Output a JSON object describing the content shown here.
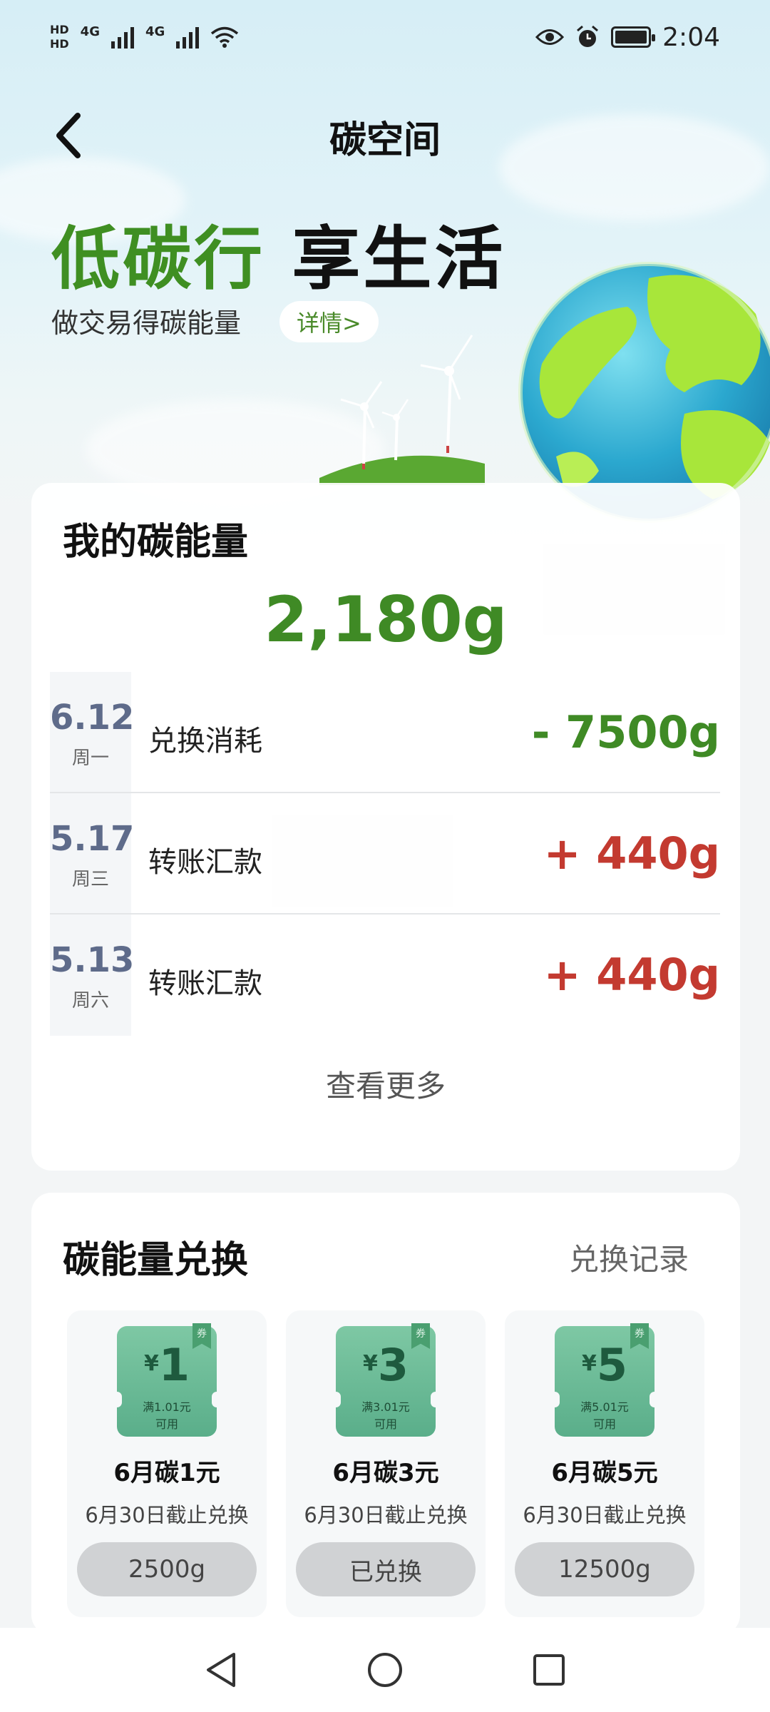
{
  "status_bar": {
    "sim1_label": "HD",
    "sim2_label": "HD",
    "network1": "4G",
    "network2": "4G",
    "time": "2:04",
    "icons": [
      "signal-icon",
      "wifi-icon",
      "eye-icon",
      "alarm-icon",
      "battery-icon"
    ]
  },
  "header": {
    "title": "碳空间",
    "back_icon": "back-chevron-icon"
  },
  "hero": {
    "slogan_green": "低碳行",
    "slogan_dark": "享生活",
    "subtitle": "做交易得碳能量",
    "details_label": "详情>"
  },
  "energy": {
    "title": "我的碳能量",
    "value": "2,180g",
    "records": [
      {
        "date": "6.12",
        "weekday": "周一",
        "label": "兑换消耗",
        "amount": "- 7500g",
        "type": "minus"
      },
      {
        "date": "5.17",
        "weekday": "周三",
        "label": "转账汇款",
        "amount": "+ 440g",
        "type": "plus"
      },
      {
        "date": "5.13",
        "weekday": "周六",
        "label": "转账汇款",
        "amount": "+ 440g",
        "type": "plus"
      }
    ],
    "view_more": "查看更多"
  },
  "exchange": {
    "title": "碳能量兑换",
    "record_link": "兑换记录",
    "coupons": [
      {
        "yen": "¥",
        "amount": "1",
        "cond1": "满1.01元",
        "cond2": "可用",
        "tag": "券",
        "name": "6月碳1元",
        "deadline": "6月30日截止兑换",
        "button": "2500g"
      },
      {
        "yen": "¥",
        "amount": "3",
        "cond1": "满3.01元",
        "cond2": "可用",
        "tag": "券",
        "name": "6月碳3元",
        "deadline": "6月30日截止兑换",
        "button": "已兑换"
      },
      {
        "yen": "¥",
        "amount": "5",
        "cond1": "满5.01元",
        "cond2": "可用",
        "tag": "券",
        "name": "6月碳5元",
        "deadline": "6月30日截止兑换",
        "button": "12500g"
      }
    ]
  },
  "colors": {
    "brand_green": "#3f8a25",
    "plus_red": "#c33a30",
    "coupon_green": "#5aae8a"
  }
}
